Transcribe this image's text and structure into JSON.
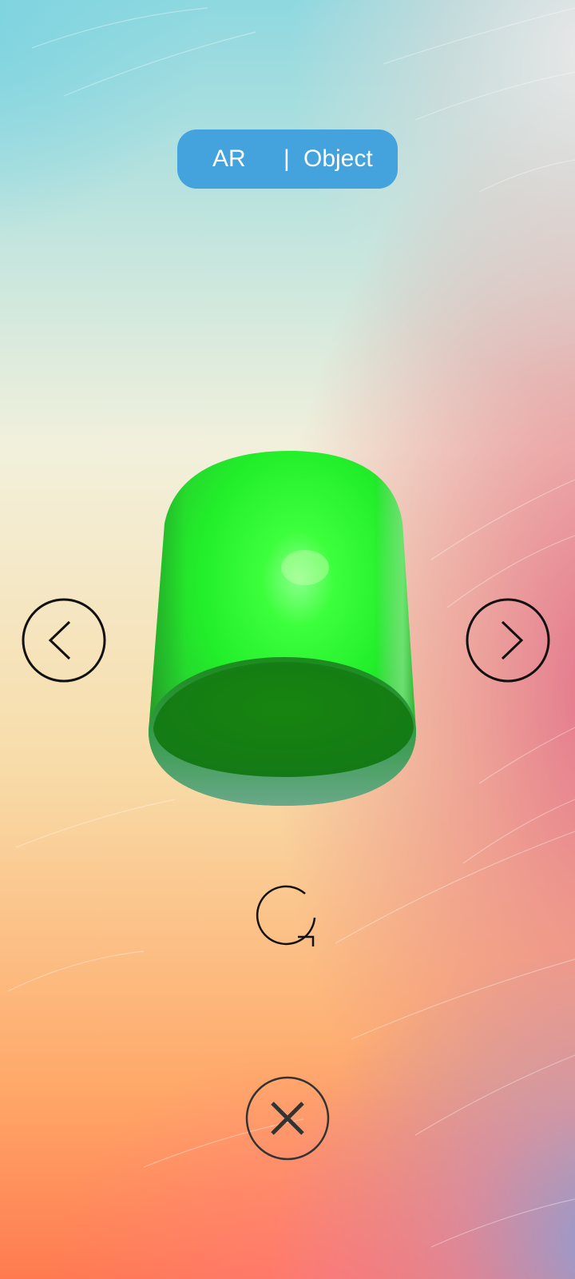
{
  "mode_toggle": {
    "ar_label": "AR",
    "separator": "|",
    "object_label": "Object"
  },
  "colors": {
    "toggle_background": "#44a3dc",
    "toggle_text": "#ffffff",
    "object_green": "#22ff33",
    "icon_stroke": "#111111"
  },
  "icons": {
    "previous": "chevron-left-icon",
    "next": "chevron-right-icon",
    "rotate": "rotate-icon",
    "close": "close-icon"
  },
  "scene_object": {
    "shape": "capsule-cylinder",
    "color": "#22ff33"
  }
}
